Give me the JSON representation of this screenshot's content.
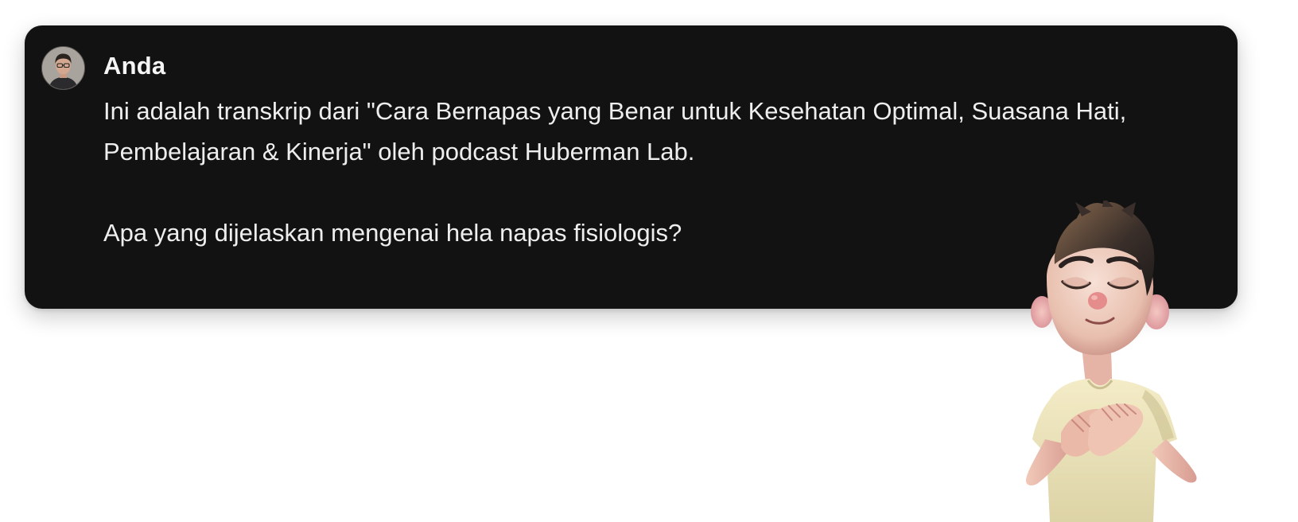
{
  "message": {
    "sender": "Anda",
    "paragraphs": [
      "Ini adalah transkrip dari \"Cara Bernapas yang Benar untuk Kesehatan Optimal, Suasana Hati, Pembelajaran & Kinerja\" oleh podcast Huberman Lab.",
      "Apa yang dijelaskan mengenai hela napas fisiologis?"
    ]
  },
  "icons": {
    "avatar": "user-avatar-photo",
    "illustration": "breathing-cartoon-character"
  },
  "colors": {
    "card_background": "#121212",
    "text": "#eeeeee",
    "page_background": "#ffffff"
  }
}
